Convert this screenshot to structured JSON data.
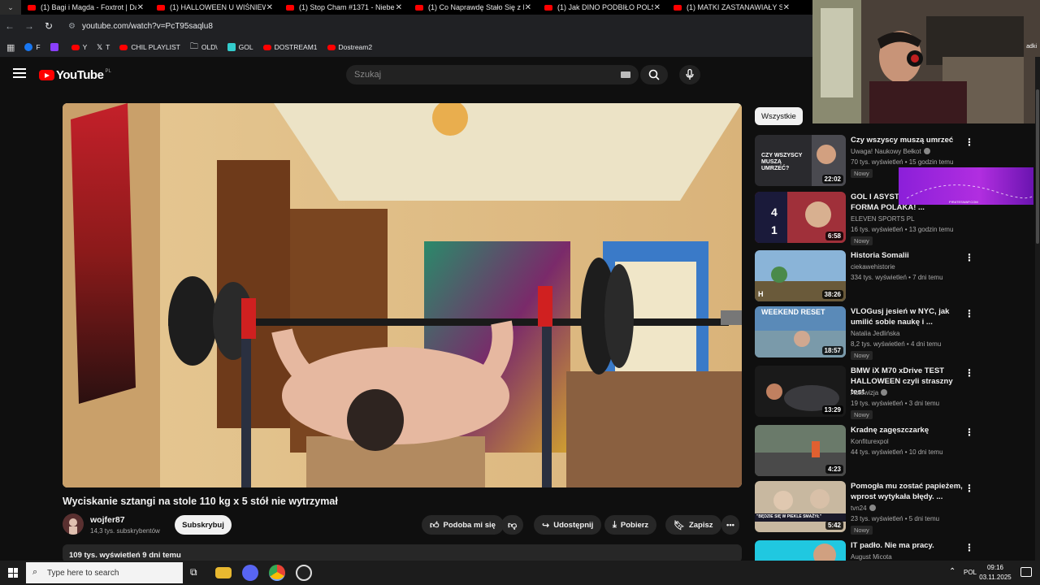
{
  "browser": {
    "tabs": [
      {
        "label": "(1) Bagi i Magda - Foxtrot | Dan"
      },
      {
        "label": "(1) HALLOWEEN U WIŚNIEWSK"
      },
      {
        "label": "(1) Stop Cham #1371 - Niebezp"
      },
      {
        "label": "(1) Co Naprawdę Stało Się z M"
      },
      {
        "label": "(1) Jak DINO PODBIŁO POLSKĘ"
      },
      {
        "label": "(1) MATKI ZASTANAWIAŁY SIĘ,"
      }
    ],
    "url": "youtube.com/watch?v=PcT95saqlu8",
    "bookmarks": [
      {
        "label": "F",
        "color": "#1877f2"
      },
      {
        "label": "",
        "color": "#8a3ffc"
      },
      {
        "label": "Y",
        "color": "#ff0000"
      },
      {
        "label": "T",
        "color": "#ffffff"
      },
      {
        "label": "CHIL PLAYLIST",
        "color": "#ff0000"
      },
      {
        "label": "OLD\\",
        "color": "folder"
      },
      {
        "label": "GOL",
        "color": "#3cc"
      },
      {
        "label": "DOSTREAM1",
        "color": "#ff0000"
      },
      {
        "label": "Dostream2",
        "color": "#ff0000"
      }
    ]
  },
  "header": {
    "logo_text": "YouTube",
    "region": "PL",
    "search_placeholder": "Szukaj"
  },
  "video": {
    "title": "Wyciskanie sztangi na stole 110 kg x 5 stół nie wytrzymał",
    "channel": "wojfer87",
    "subscribers": "14,3 tys. subskrybentów",
    "subscribe_label": "Subskrybuj",
    "like_label": "Podoba mi się",
    "share_label": "Udostępnij",
    "download_label": "Pobierz",
    "save_label": "Zapisz",
    "views_date": "109 tys. wyświetleń  9 dni temu"
  },
  "sidebar": {
    "chip": "Wszystkie",
    "items": [
      {
        "title": "Czy wszyscy muszą umrzeć",
        "channel": "Uwaga! Naukowy Bełkot",
        "meta": "70 tys. wyświetleń • 15 godzin temu",
        "badge": "Nowy",
        "duration": "22:02",
        "thumb_text": "CZY WSZYSCY MUSZĄ UMRZEĆ?"
      },
      {
        "title": "GOL I ASYSTA ... ŚWIETNA FORMA POLAKA! ...",
        "channel": "ELEVEN SPORTS PL",
        "meta": "16 tys. wyświetleń • 13 godzin temu",
        "badge": "Nowy",
        "duration": "6:58",
        "thumb_text": "4 1"
      },
      {
        "title": "Historia Somalii",
        "channel": "ciekawehistorie",
        "meta": "334 tys. wyświetleń • 7 dni temu",
        "badge": "",
        "duration": "38:26",
        "thumb_text": ""
      },
      {
        "title": "VLOGusj jesień w NYC, jak umilić sobie naukę i ...",
        "channel": "Natalia Jedlińska",
        "meta": "8,2 tys. wyświetleń • 4 dni temu",
        "badge": "Nowy",
        "duration": "18:57",
        "thumb_text": "WEEKEND RESET"
      },
      {
        "title": "BMW iX M70 xDrive TEST HALLOWEEN czyli straszny test",
        "channel": "Autowizja",
        "meta": "19 tys. wyświetleń • 3 dni temu",
        "badge": "Nowy",
        "duration": "13:29",
        "thumb_text": ""
      },
      {
        "title": "Kradnę zagęszczarkę",
        "channel": "Konfiturexpol",
        "meta": "44 tys. wyświetleń • 10 dni temu",
        "badge": "",
        "duration": "4:23",
        "thumb_text": ""
      },
      {
        "title": "Pomogła mu zostać papieżem, wprost wytykała błędy. ...",
        "channel": "tvn24",
        "meta": "23 tys. wyświetleń • 5 dni temu",
        "badge": "Nowy",
        "duration": "5:42",
        "thumb_text": "\"BĘDZIE SIĘ W PIEKLE SMAŻYŁ\""
      },
      {
        "title": "IT padło. Nie ma pracy.",
        "channel": "August Micota",
        "meta": "",
        "badge": "",
        "duration": "",
        "thumb_text": ""
      }
    ]
  },
  "overlay": {
    "banner_text": "PIRATESWAP.COM",
    "webcam_side_text": "adki"
  },
  "taskbar": {
    "search_placeholder": "Type here to search",
    "language": "POL",
    "time": "09:16",
    "date": "03.11.2025"
  }
}
